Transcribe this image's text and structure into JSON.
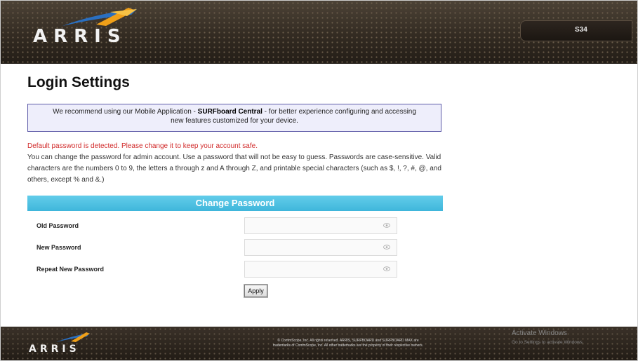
{
  "header": {
    "brand": "ARRIS",
    "model": "S34"
  },
  "main": {
    "page_title": "Login Settings",
    "notice": {
      "prefix": "We recommend using our Mobile Application - ",
      "app_name": "SURFboard Central",
      "suffix": " - for better experience configuring and accessing",
      "line2": "new features customized for your device."
    },
    "warning": "Default password is detected. Please change it to keep your account safe.",
    "description": "You can change the password for admin account. Use a password that will not be easy to guess. Passwords are case-sensitive. Valid characters are the numbers 0 to 9, the letters a through z and A through Z, and printable special characters (such as $, !, ?, #, @, and others, except % and &.)"
  },
  "change_password": {
    "title": "Change Password",
    "old_password": {
      "label": "Old Password",
      "value": "",
      "placeholder": ""
    },
    "new_password": {
      "label": "New Password",
      "value": "",
      "placeholder": ""
    },
    "repeat_password": {
      "label": "Repeat New Password",
      "value": "",
      "placeholder": ""
    },
    "apply_label": "Apply"
  },
  "footer": {
    "brand": "ARRIS",
    "copyright_line1": "© CommScope, Inc. All rights reserved. ARRIS, SURFBOARD and SURFBOARD MAX are",
    "copyright_line2": "trademarks of CommScope, Inc. All other trademarks are the property of their respective owners."
  },
  "os_watermark": {
    "title": "Activate Windows",
    "subtitle": "Go to Settings to activate Windows."
  },
  "colors": {
    "header_bg": "#332b22",
    "accent_blue": "#3fb6db",
    "notice_border": "#5d5aa8",
    "warning_red": "#d12a2a",
    "logo_orange": "#f0a019",
    "logo_blue": "#2a6fc0"
  }
}
